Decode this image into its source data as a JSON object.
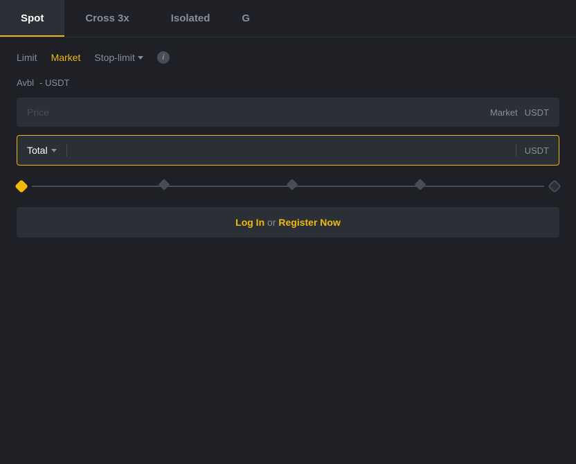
{
  "tabs": [
    {
      "id": "spot",
      "label": "Spot",
      "active": false
    },
    {
      "id": "cross3x",
      "label": "Cross 3x",
      "active": false
    },
    {
      "id": "isolated",
      "label": "Isolated",
      "active": false
    },
    {
      "id": "more",
      "label": "G",
      "active": false
    }
  ],
  "orderTypes": [
    {
      "id": "limit",
      "label": "Limit",
      "active": false
    },
    {
      "id": "market",
      "label": "Market",
      "active": true
    },
    {
      "id": "stoplimit",
      "label": "Stop-limit",
      "active": false
    }
  ],
  "info_icon_label": "i",
  "avbl": {
    "label": "Avbl",
    "value": "- USDT"
  },
  "price_input": {
    "placeholder": "Price",
    "market_label": "Market",
    "currency": "USDT"
  },
  "total_input": {
    "dropdown_label": "Total",
    "placeholder": "",
    "currency": "USDT"
  },
  "slider": {
    "nodes": [
      0,
      25,
      50,
      75,
      100
    ]
  },
  "login_button": {
    "login_text": "Log In",
    "or_text": " or ",
    "register_text": "Register Now"
  },
  "colors": {
    "accent": "#f0b90b",
    "bg_primary": "#1e2026",
    "bg_secondary": "#2b2f36",
    "text_muted": "#848e9c",
    "tab_active_bg": "#2b2f36"
  }
}
